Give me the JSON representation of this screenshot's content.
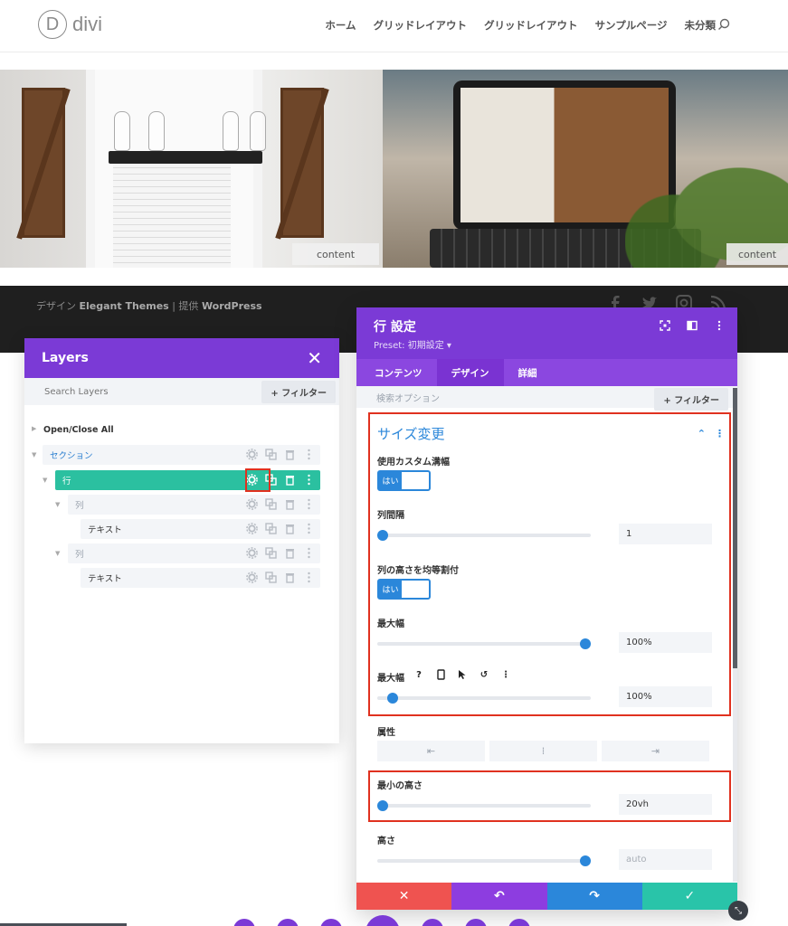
{
  "site": {
    "logo_letter": "D",
    "logo_text": "divi",
    "nav": [
      "ホーム",
      "グリッドレイアウト",
      "グリッドレイアウト",
      "サンプルページ",
      "未分類"
    ],
    "hero_label_left": "content",
    "hero_label_right": "content",
    "footer_prefix": "デザイン",
    "footer_brand": "Elegant Themes",
    "footer_sep": "| 提供",
    "footer_wp": "WordPress"
  },
  "layers": {
    "title": "Layers",
    "close": "✕",
    "search_placeholder": "Search Layers",
    "filter_label": "+ フィルター",
    "open_close_all": "Open/Close All",
    "section": "セクション",
    "row": "行",
    "col1": "列",
    "text1": "テキスト",
    "col2": "列",
    "text2": "テキスト"
  },
  "modal": {
    "title": "行 設定",
    "preset": "Preset: 初期設定 ▾",
    "tabs": [
      "コンテンツ",
      "デザイン",
      "詳細"
    ],
    "active_tab": "デザイン",
    "search_placeholder": "検索オプション",
    "filter_label": "+ フィルター",
    "section_title": "サイズ変更",
    "fields": {
      "custom_gutter": {
        "label": "使用カスタム溝幅",
        "toggle": "はい"
      },
      "gutter": {
        "label": "列間隔",
        "value": "1",
        "fill": 0.0
      },
      "equal_height": {
        "label": "列の高さを均等割付",
        "toggle": "はい"
      },
      "max_width": {
        "label": "最大幅",
        "value": "100%",
        "fill": 1.0
      },
      "max_width2": {
        "label": "最大幅",
        "value": "100%",
        "fill": 0.05
      },
      "alignment": {
        "label": "属性"
      },
      "min_height": {
        "label": "最小の高さ",
        "value": "20vh",
        "fill": 0.0
      },
      "height": {
        "label": "高さ",
        "value": "auto",
        "fill": 1.0
      }
    }
  },
  "colors": {
    "purple": "#7b3ad6",
    "teal": "#2bc0a0",
    "blue": "#2b87da",
    "red": "#ef5350",
    "highlight": "#e0311f"
  }
}
